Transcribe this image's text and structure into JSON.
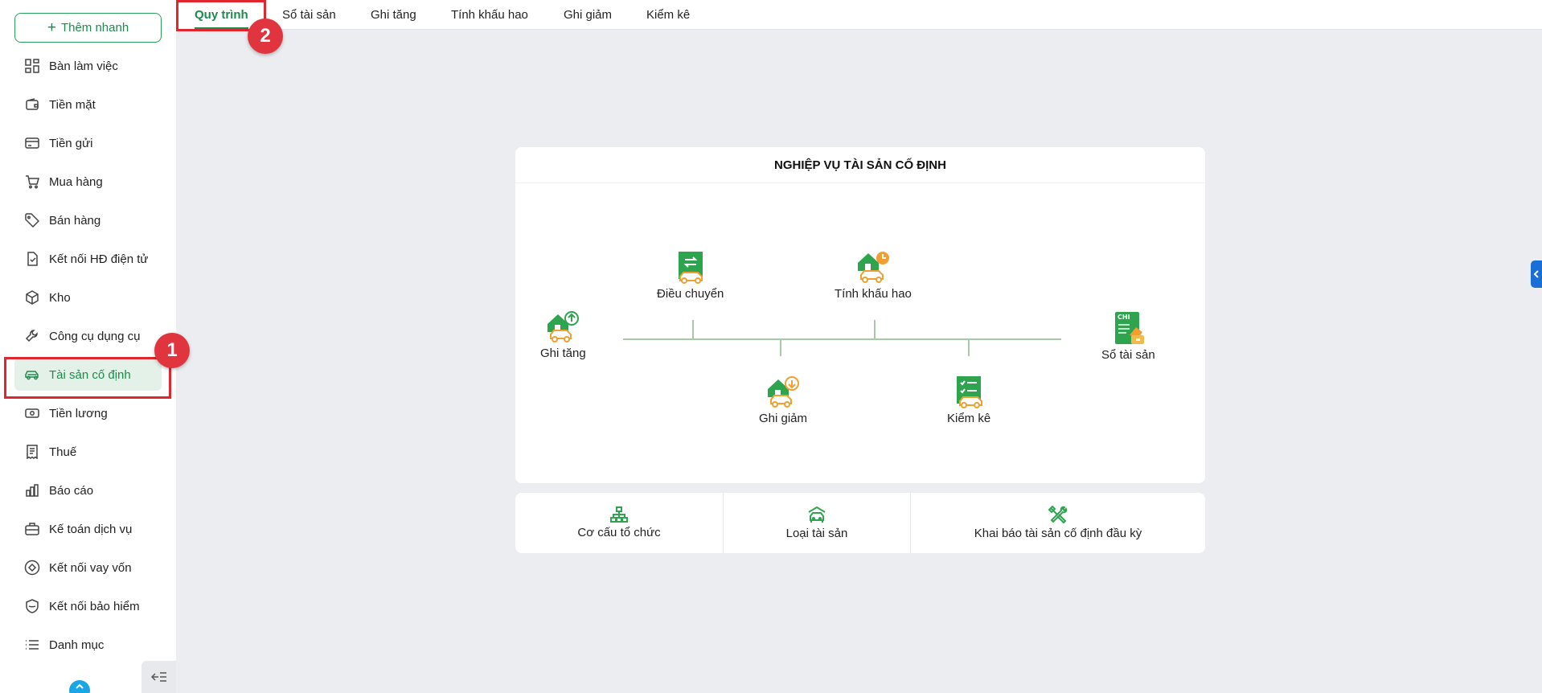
{
  "sidebar": {
    "quick_add_label": "Thêm nhanh",
    "items": [
      {
        "label": "Bàn làm việc",
        "icon": "dashboard-icon"
      },
      {
        "label": "Tiền mặt",
        "icon": "wallet-icon"
      },
      {
        "label": "Tiền gửi",
        "icon": "card-icon"
      },
      {
        "label": "Mua hàng",
        "icon": "cart-icon"
      },
      {
        "label": "Bán hàng",
        "icon": "tag-icon"
      },
      {
        "label": "Kết nối HĐ điện tử",
        "icon": "invoice-icon"
      },
      {
        "label": "Kho",
        "icon": "box-icon"
      },
      {
        "label": "Công cụ dụng cụ",
        "icon": "wrench-icon"
      },
      {
        "label": "Tài sản cố định",
        "icon": "car-icon",
        "active": true
      },
      {
        "label": "Tiền lương",
        "icon": "money-icon"
      },
      {
        "label": "Thuế",
        "icon": "receipt-icon"
      },
      {
        "label": "Báo cáo",
        "icon": "bar-chart-icon"
      },
      {
        "label": "Kế toán dịch vụ",
        "icon": "briefcase-icon"
      },
      {
        "label": "Kết nối vay vốn",
        "icon": "loan-icon"
      },
      {
        "label": "Kết nối bảo hiểm",
        "icon": "shield-icon"
      },
      {
        "label": "Danh mục",
        "icon": "list-icon"
      }
    ]
  },
  "tabs": [
    {
      "label": "Quy trình",
      "active": true
    },
    {
      "label": "Sổ tài sản"
    },
    {
      "label": "Ghi tăng"
    },
    {
      "label": "Tính khấu hao"
    },
    {
      "label": "Ghi giảm"
    },
    {
      "label": "Kiểm kê"
    }
  ],
  "annotations": {
    "badge_1": "1",
    "badge_2": "2"
  },
  "process": {
    "title": "NGHIỆP VỤ TÀI SẢN CỐ ĐỊNH",
    "nodes": {
      "ghi_tang": "Ghi tăng",
      "dieu_chuyen": "Điều chuyển",
      "tinh_khau_hao": "Tính khấu hao",
      "ghi_giam": "Ghi giảm",
      "kiem_ke": "Kiểm kê",
      "so_tai_san": "Sổ tài sản",
      "chi_badge": "CHI"
    }
  },
  "bottom": {
    "co_cau": "Cơ cấu tổ chức",
    "loai_tai_san": "Loại tài sản",
    "khai_bao": "Khai báo tài sản cố định đầu kỳ"
  },
  "colors": {
    "primary_green": "#1f8a4c",
    "icon_green": "#2ea44f",
    "icon_orange": "#f0a030",
    "annotation_red": "#e0262e"
  }
}
